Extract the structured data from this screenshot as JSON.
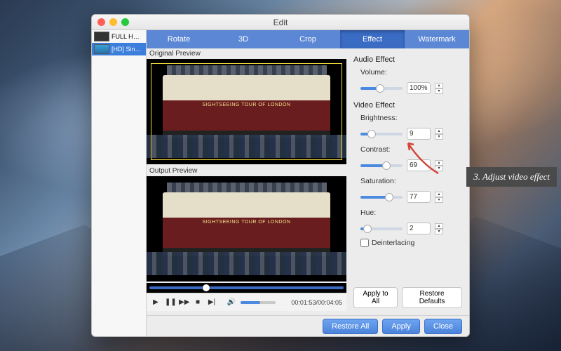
{
  "window": {
    "title": "Edit"
  },
  "clips": [
    {
      "label": "FULL HD ...",
      "selected": false
    },
    {
      "label": "[HD] Sing-...",
      "selected": true
    }
  ],
  "tabs": [
    {
      "label": "Rotate",
      "active": false
    },
    {
      "label": "3D",
      "active": false
    },
    {
      "label": "Crop",
      "active": false
    },
    {
      "label": "Effect",
      "active": true
    },
    {
      "label": "Watermark",
      "active": false
    }
  ],
  "preview": {
    "original_label": "Original Preview",
    "output_label": "Output Preview",
    "bus_text": "SIGHTSEEING TOUR OF LONDON"
  },
  "transport": {
    "play": "▶",
    "pause": "❚❚",
    "ff": "▶▶",
    "stop": "■",
    "next": "▶|",
    "vol_icon": "🔊",
    "time": "00:01:53/00:04:05"
  },
  "effects": {
    "audio_section": "Audio Effect",
    "volume_label": "Volume:",
    "volume_value": "100%",
    "video_section": "Video Effect",
    "brightness_label": "Brightness:",
    "brightness_value": "9",
    "contrast_label": "Contrast:",
    "contrast_value": "69",
    "saturation_label": "Saturation:",
    "saturation_value": "77",
    "hue_label": "Hue:",
    "hue_value": "2",
    "deinterlace_label": "Deinterlacing",
    "apply_all": "Apply to All",
    "restore_defaults": "Restore Defaults"
  },
  "footer": {
    "restore_all": "Restore All",
    "apply": "Apply",
    "close": "Close"
  },
  "annotation": {
    "text": "3. Adjust video effect"
  }
}
